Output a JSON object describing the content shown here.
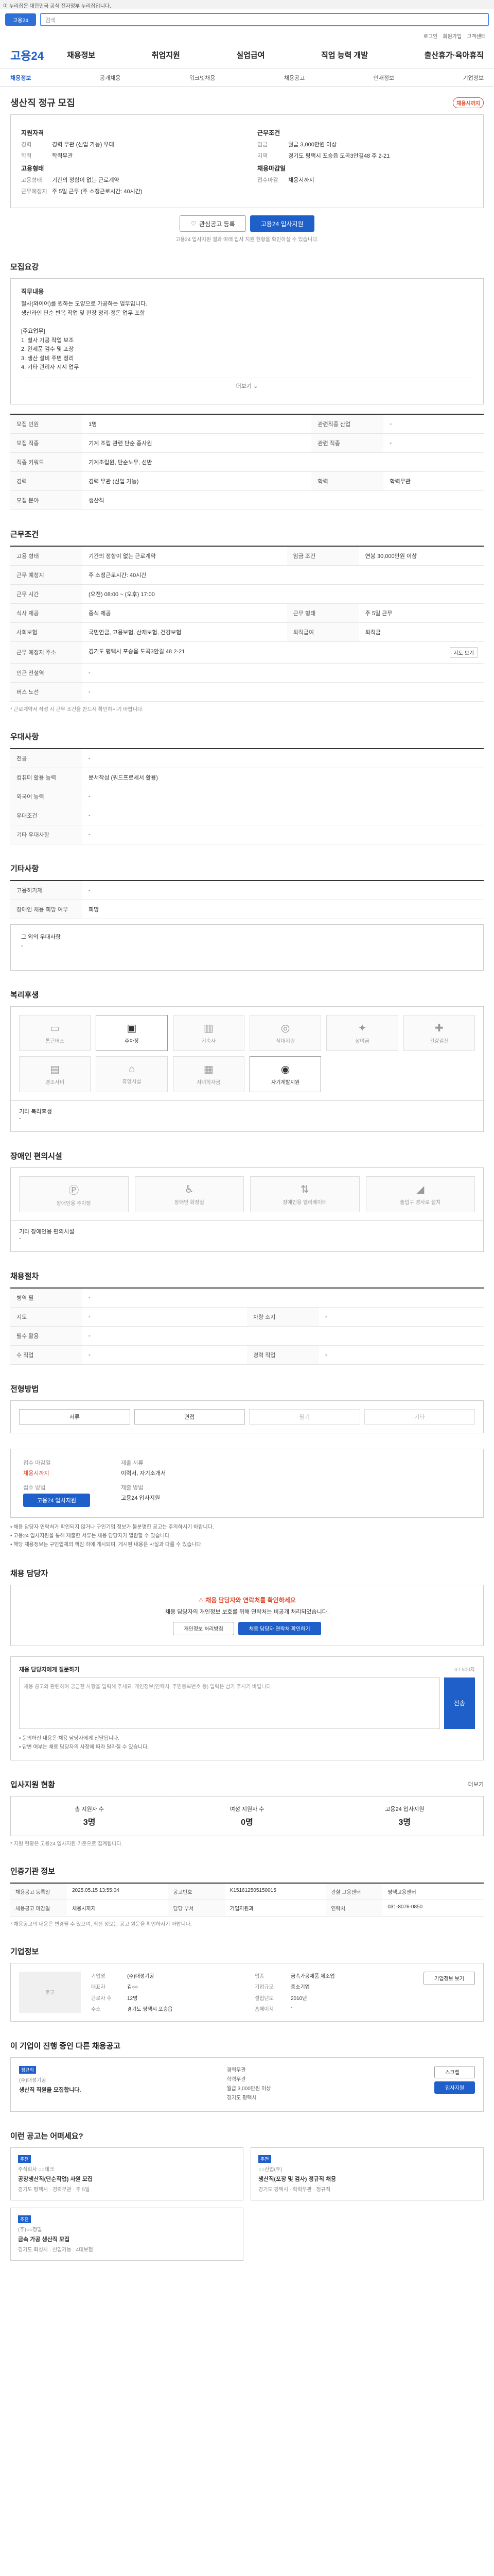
{
  "gov_banner": "이 누리집은 대한민국 공식 전자정부 누리집입니다.",
  "search": {
    "logo": "고용24",
    "placeholder": "검색"
  },
  "util": [
    "로그인",
    "회원가입",
    "고객센터"
  ],
  "brand": "고용24",
  "menu": [
    "채용정보",
    "취업지원",
    "실업급여",
    "직업 능력 개발",
    "출산휴가·육아휴직"
  ],
  "subnav": [
    "채용정보",
    "공개채용",
    "워크넷채용",
    "채용공고",
    "인재정보",
    "기업정보"
  ],
  "job_title": "생산직 정규 모집",
  "status_badge": "채용시까지",
  "summary": {
    "left_title": "지원자격",
    "left": [
      {
        "k": "경력",
        "v": "경력 무관 (신입 가능) 우대"
      },
      {
        "k": "학력",
        "v": "학력무관"
      }
    ],
    "left_title2": "고용형태",
    "left2": [
      {
        "k": "고용형태",
        "v": "기간의 정함이 없는 근로계약"
      },
      {
        "k": "근무예정지",
        "v": "주 5일 근무 (주 소정근로시간: 40시간)"
      }
    ],
    "right_title": "근무조건",
    "right": [
      {
        "k": "임금",
        "v": "월급 3,000만원 이상"
      },
      {
        "k": "지역",
        "v": "경기도 평택시 포승읍 도곡3안길48 주 2-21"
      }
    ],
    "right_title2": "채용마감일",
    "right2": [
      {
        "k": "접수마감",
        "v": "채용시까지"
      }
    ]
  },
  "actions": {
    "scrap": "관심공고 등록",
    "apply": "고용24 입사지원"
  },
  "actions_note": "고용24 입사지원 결과 아래 입사 지원 현황을 확인하실 수 있습니다.",
  "recruit": {
    "title": "모집요강",
    "label": "직무내용",
    "lines": [
      "철사(와이어)를 원하는 모양으로 가공하는 업무입니다.",
      "생산라인 단순 반복 작업 및 현장 정리·정돈 업무 포함",
      "",
      "[주요업무]",
      "1. 철사 가공 작업 보조",
      "2. 완제품 검수 및 포장",
      "3. 생산 설비 주변 정리",
      "4. 기타 관리자 지시 업무"
    ],
    "more": "더보기"
  },
  "recruit_table": [
    {
      "k": "모집 인원",
      "v": "1명",
      "k2": "관련직종 산업",
      "v2": "-"
    },
    {
      "k": "모집 직종",
      "v": "기계 조립 관련 단순 종사원",
      "k2": "관련 직종",
      "v2": "-"
    },
    {
      "k": "직종 키워드",
      "v": "기계조립원, 단순노무, 선반",
      "k2": "",
      "v2": ""
    },
    {
      "k": "경력",
      "v": "경력 무관 (신입 가능)",
      "k2": "학력",
      "v2": "학력무관"
    },
    {
      "k": "모집 분야",
      "v": "생산직",
      "k2": "",
      "v2": ""
    }
  ],
  "work": {
    "title": "근무조건",
    "rows": [
      {
        "k": "고용 형태",
        "v": "기간의 정함이 없는 근로계약",
        "k2": "임금 조건",
        "v2": "연봉 30,000만원 이상"
      },
      {
        "k": "근무 예정지",
        "v": "주 소정근로시간: 40시간",
        "k2": "",
        "v2": ""
      },
      {
        "k": "근무 시간",
        "v": "(오전) 08:00 ~ (오후) 17:00",
        "k2": "",
        "v2": ""
      },
      {
        "k": "식사 제공",
        "v": "중식 제공",
        "k2": "근무 형태",
        "v2": "주 5일 근무"
      },
      {
        "k": "사회보험",
        "v": "국민연금, 고용보험, 산재보험, 건강보험",
        "k2": "퇴직급여",
        "v2": "퇴직금"
      },
      {
        "k": "근무 예정지 주소",
        "v": "경기도 평택시 포승읍 도곡3안길 48 2-21",
        "k2": "",
        "v2": ""
      },
      {
        "k": "인근 전철역",
        "v": "-",
        "k2": "",
        "v2": ""
      },
      {
        "k": "버스 노선",
        "v": "-",
        "k2": "",
        "v2": ""
      }
    ],
    "map_btn": "지도 보기",
    "footnote": "* 근로계약서 작성 시 근무 조건을 반드시 확인하시기 바랍니다."
  },
  "preference": {
    "title": "우대사항",
    "rows": [
      {
        "k": "전공",
        "v": "-"
      },
      {
        "k": "컴퓨터 활용 능력",
        "v": "문서작성 (워드프로세서 활용)"
      },
      {
        "k": "외국어 능력",
        "v": "-"
      },
      {
        "k": "우대조건",
        "v": "-"
      },
      {
        "k": "기타 우대사항",
        "v": "-"
      }
    ]
  },
  "screening": {
    "title": "기타사항",
    "rows": [
      {
        "k": "고용허가제",
        "v": "-"
      },
      {
        "k": "장애인 채용 희망 여부",
        "v": "희망"
      }
    ],
    "etc_label": "그 외의 우대사항",
    "etc_value": "-"
  },
  "welfare": {
    "title": "복리후생",
    "items": [
      {
        "label": "통근버스",
        "on": false,
        "icon": "bus-icon",
        "glyph": "▭"
      },
      {
        "label": "주차장",
        "on": true,
        "icon": "car-icon",
        "glyph": "▣"
      },
      {
        "label": "기숙사",
        "on": false,
        "icon": "building-icon",
        "glyph": "▥"
      },
      {
        "label": "식대지원",
        "on": false,
        "icon": "food-icon",
        "glyph": "◎"
      },
      {
        "label": "상여금",
        "on": false,
        "icon": "gift-icon",
        "glyph": "✦"
      },
      {
        "label": "건강검진",
        "on": false,
        "icon": "health-icon",
        "glyph": "✚"
      },
      {
        "label": "경조사비",
        "on": false,
        "icon": "wallet-icon",
        "glyph": "▤"
      },
      {
        "label": "휴양시설",
        "on": false,
        "icon": "home-icon",
        "glyph": "⌂"
      },
      {
        "label": "자녀학자금",
        "on": false,
        "icon": "book-icon",
        "glyph": "▦"
      },
      {
        "label": "자기계발지원",
        "on": true,
        "icon": "target-icon",
        "glyph": "◉"
      }
    ],
    "etc_label": "기타 복리후생",
    "etc_value": "-"
  },
  "facility": {
    "title": "장애인 편의시설",
    "items": [
      "장애인용 주차장",
      "장애인 화장실",
      "장애인용 엘리베이터",
      "출입구 경사로 설치"
    ],
    "etc_label": "기타 장애인용 편의시설",
    "etc_value": "-"
  },
  "extra": {
    "title": "채용절차",
    "rows": [
      {
        "k": "병역 필",
        "v": "-",
        "k2": "",
        "v2": ""
      },
      {
        "k": "지도",
        "v": "-",
        "k2": "차량 소지",
        "v2": "-"
      },
      {
        "k": "필수 활용",
        "v": "-",
        "k2": "",
        "v2": ""
      },
      {
        "k": "수 직업",
        "v": "-",
        "k2": "경력 직업",
        "v2": "-"
      }
    ]
  },
  "process": {
    "title": "전형방법",
    "steps": [
      {
        "label": "서류",
        "dim": false
      },
      {
        "label": "면접",
        "dim": false
      },
      {
        "label": "필기",
        "dim": true
      },
      {
        "label": "기타",
        "dim": true
      }
    ]
  },
  "apply": {
    "c1t": "접수 마감일",
    "c1v": "채용시까지",
    "c1t2": "접수 방법",
    "c1v2": "고용24 입사지원",
    "c2t": "제출 서류",
    "c2v": "이력서, 자기소개서",
    "c2t2": "제출 방법",
    "c2v2": "고용24 입사지원",
    "notes": [
      "• 채용 담당자 연락처가 확인되지 않거나 구인기업 정보가 불분명한 공고는 주의하시기 바랍니다.",
      "• 고용24 입사지원을 통해 제출한 서류는 채용 담당자가 열람할 수 있습니다.",
      "• 해당 채용정보는 구인업체의 책임 하에 게시되며, 게시된 내용은 사실과 다를 수 있습니다."
    ]
  },
  "contact": {
    "title": "채용 담당자",
    "alert_title": "채용 담당자와 연락처를 확인하세요",
    "alert_text": "채용 담당자의 개인정보 보호를 위해 연락처는 비공개 처리되었습니다.",
    "btn1": "개인정보 처리방침",
    "btn2": "채용 담당자 연락처 확인하기"
  },
  "ask": {
    "title": "채용 담당자에게 질문하기",
    "counter": "0 / 500자",
    "placeholder": "채용 공고와 관련하여 궁금한 사항을 입력해 주세요. 개인정보(연락처, 주민등록번호 등) 입력은 삼가 주시기 바랍니다.",
    "send": "전송",
    "notes": [
      "• 문의하신 내용은 채용 담당자에게 전달됩니다.",
      "• 답변 여부는 채용 담당자의 사정에 따라 달라질 수 있습니다."
    ]
  },
  "stats": {
    "title": "입사지원 현황",
    "more": "더보기",
    "items": [
      {
        "label": "총 지원자 수",
        "n": "3명"
      },
      {
        "label": "여성 지원자 수",
        "n": "0명"
      },
      {
        "label": "고용24 입사지원",
        "n": "3명"
      }
    ],
    "note": "* 지원 현황은 고용24 입사지원 기준으로 집계됩니다."
  },
  "reg": {
    "title": "인증기관 정보",
    "rows": [
      {
        "k": "채용공고 등록일",
        "v": "2025.05.15 13:55:04",
        "k2": "공고번호",
        "v2": "K151612505150015",
        "k3": "관할 고용센터",
        "v3": "평택고용센터"
      },
      {
        "k": "채용공고 마감일",
        "v": "채용시까지",
        "k2": "담당 부서",
        "v2": "기업지원과",
        "k3": "연락처",
        "v3": "031-8076-0850"
      }
    ],
    "note": "* 채용공고의 내용은 변경될 수 있으며, 최신 정보는 공고 원문을 확인하시기 바랍니다."
  },
  "company": {
    "title": "기업정보",
    "btn": "기업정보 보기",
    "logo": "로고",
    "rows": [
      {
        "k": "기업명",
        "v": "(주)대성기공",
        "k2": "업종",
        "v2": "금속가공제품 제조업"
      },
      {
        "k": "대표자",
        "v": "김○○",
        "k2": "기업규모",
        "v2": "중소기업"
      },
      {
        "k": "근로자 수",
        "v": "12명",
        "k2": "설립년도",
        "v2": "2010년"
      },
      {
        "k": "주소",
        "v": "경기도 평택시 포승읍",
        "k2": "홈페이지",
        "v2": "-"
      }
    ]
  },
  "other_jobs": {
    "title": "이 기업이 진행 중인 다른 채용공고",
    "tag": "정규직",
    "company": "(주)대성기공",
    "job": "생산직 직원을 모집합니다.",
    "meta": [
      "경력무관",
      "학력무관",
      "월급 3,000만원 이상",
      "경기도 평택시"
    ],
    "btns": [
      "스크랩",
      "입사지원"
    ]
  },
  "recommend": {
    "title": "이런 공고는 어떠세요?",
    "cards": [
      {
        "tag": "추천",
        "company": "주식회사 ○○테크",
        "title": "공장생산직(단순작업) 사원 모집",
        "meta": "경기도 평택시 · 경력무관 · 주 5일"
      },
      {
        "tag": "추천",
        "company": "○○산업(주)",
        "title": "생산직(포장 및 검사) 정규직 채용",
        "meta": "경기도 평택시 · 학력무관 · 정규직"
      },
      {
        "tag": "추천",
        "company": "(주)○○정밀",
        "title": "금속 가공 생산직 모집",
        "meta": "경기도 화성시 · 신입가능 · 4대보험"
      }
    ]
  }
}
